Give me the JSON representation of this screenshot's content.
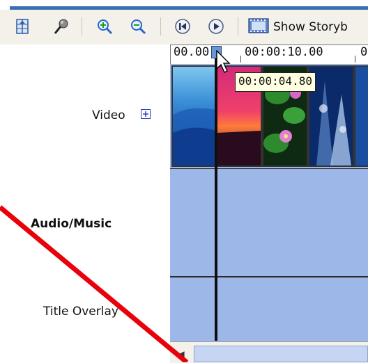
{
  "toolbar": {
    "show_storyboard_label": "Show Storyb",
    "icons": [
      "storyboard-timeline-icon",
      "narrate-microphone-icon",
      "zoom-in-icon",
      "zoom-out-icon",
      "rewind-icon",
      "play-icon",
      "filmstrip-icon"
    ]
  },
  "timeline": {
    "ruler_start": "00.00",
    "ruler_mark": "00:00:10.00",
    "ruler_end": "0",
    "tooltip_time": "00:00:04.80"
  },
  "tracks": {
    "video_label": "Video",
    "audio_label": "Audio/Music",
    "title_label": "Title Overlay"
  },
  "colors": {
    "track_bg": "#9db8e8",
    "playhead": "#0f0f0f",
    "annotation_line": "#e8000a"
  }
}
